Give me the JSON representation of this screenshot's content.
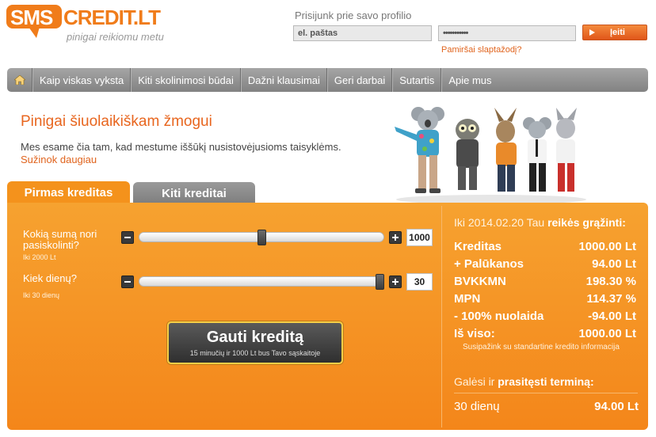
{
  "logo": {
    "brand_sms": "SMS",
    "brand_credit": "CREDIT.LT",
    "tagline": "pinigai reikiomu metu"
  },
  "login": {
    "title": "Prisijunk prie savo profilio",
    "email_value": "el. paštas",
    "password_value": "•••••••••••",
    "button_label": "Įeiti",
    "forgot_link": "Pamiršai slaptažodį?"
  },
  "nav": {
    "home_icon": "home-icon",
    "items": [
      {
        "label": "Kaip viskas vyksta"
      },
      {
        "label": "Kiti skolinimosi būdai"
      },
      {
        "label": "Dažni klausimai"
      },
      {
        "label": "Geri darbai"
      },
      {
        "label": "Sutartis"
      },
      {
        "label": "Apie mus"
      }
    ]
  },
  "intro": {
    "title": "Pinigai šiuolaikiškam žmogui",
    "text": "Mes esame čia tam, kad mestume iššūkį nusistovėjusioms taisyklėms.",
    "link": "Sužinok daugiau"
  },
  "tabs": {
    "active": "Pirmas kreditas",
    "inactive": "Kiti kreditai"
  },
  "calculator": {
    "amount": {
      "label_line1": "Kokią sumą nori",
      "label_line2": "pasiskolinti?",
      "sub": "Iki 2000 Lt",
      "value": "1000",
      "fraction": 0.5
    },
    "days": {
      "label": "Kiek dienų?",
      "sub": "Iki 30 dienų",
      "value": "30",
      "fraction": 1.0
    },
    "cta_main": "Gauti kreditą",
    "cta_sub": "15 minučių ir 1000 Lt bus Tavo sąskaitoje"
  },
  "summary": {
    "heading_prefix": "Iki 2014.02.20 Tau",
    "heading_bold": "reikės grąžinti:",
    "rows": [
      {
        "label": "Kreditas",
        "value": "1000.00 Lt"
      },
      {
        "label": "+ Palūkanos",
        "value": "94.00 Lt"
      },
      {
        "label": "BVKKMN",
        "value": "198.30 %"
      },
      {
        "label": "MPN",
        "value": "114.37 %"
      },
      {
        "label": "- 100% nuolaida",
        "value": "-94.00 Lt"
      },
      {
        "label": "Iš viso:",
        "value": "1000.00 Lt"
      }
    ],
    "note": "Susipažink su standartine kredito informacija",
    "extend_prefix": "Galėsi ir",
    "extend_bold": "prasitęsti terminą:",
    "extend_label": "30 dienų",
    "extend_value": "94.00 Lt"
  },
  "colors": {
    "brand_orange": "#f07c1a",
    "panel_orange": "#f4921c",
    "nav_gray": "#8f8f8f"
  }
}
